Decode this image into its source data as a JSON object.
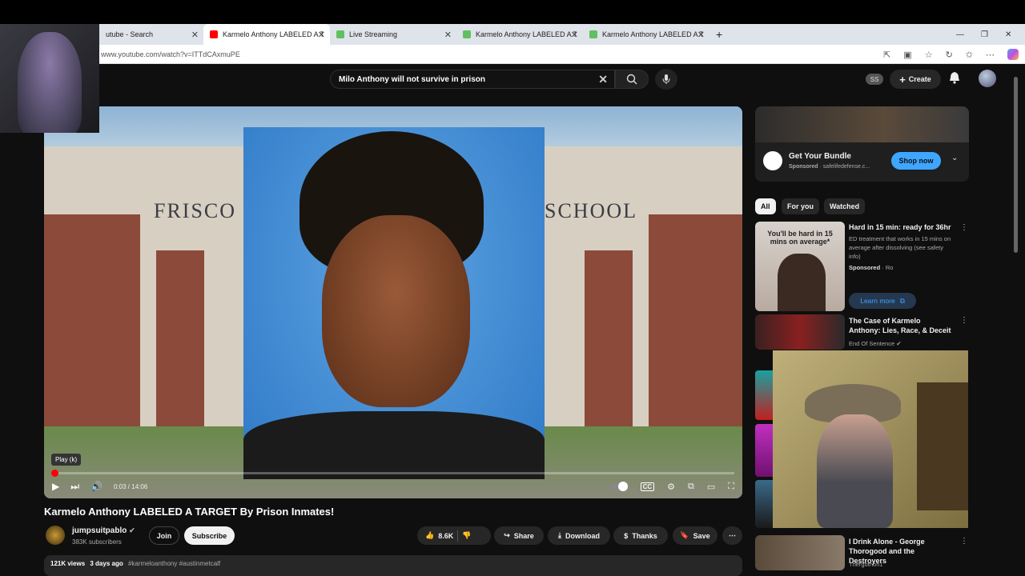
{
  "browser": {
    "tabs": [
      {
        "label": "utube - Search",
        "favicon_color": "#dfe3ea",
        "active": false
      },
      {
        "label": "Karmelo Anthony LABELED A TAR",
        "favicon_color": "#ff0000",
        "active": true
      },
      {
        "label": "Live Streaming",
        "favicon_color": "#60c060",
        "active": false
      },
      {
        "label": "Karmelo Anthony LABELED A TAR",
        "favicon_color": "#60c060",
        "active": false
      },
      {
        "label": "Karmelo Anthony LABELED A TAR",
        "favicon_color": "#60c060",
        "active": false
      }
    ],
    "url": "www.youtube.com/watch?v=ITTdCAxmuPE"
  },
  "header": {
    "search_query": "Milo Anthony will not survive in prison",
    "account_badge": "SS",
    "create_label": "Create"
  },
  "video": {
    "sign_left": "FRISCO",
    "sign_right": "SCHOOL",
    "tooltip": "Play (k)",
    "time_current": "0:03",
    "time_sep": " / ",
    "time_total": "14:06",
    "progress_fraction": 0.004
  },
  "meta": {
    "title": "Karmelo Anthony LABELED A TARGET By Prison Inmates!",
    "channel": "jumpsuitpablo",
    "subscribers": "383K subscribers",
    "join_label": "Join",
    "subscribe_label": "Subscribe",
    "likes": "8.6K",
    "share_label": "Share",
    "download_label": "Download",
    "thanks_label": "Thanks",
    "save_label": "Save",
    "views": "121K views",
    "age": "3 days ago",
    "tags": "#karmeloanthony #austinmetcalf"
  },
  "ad": {
    "title": "Get Your Bundle",
    "sponsored": "Sponsored",
    "domain": "safelifedefense.c...",
    "cta": "Shop now"
  },
  "chips": [
    "All",
    "For you",
    "Watched"
  ],
  "recommendations": [
    {
      "thumb_text": "You'll be hard in 15 mins on average*",
      "title": "Hard in 15 min: ready for 36hr",
      "sub1": "ED treatment that works in 15 mins on average after dissolving (see safety info)",
      "sponsored": "Sponsored",
      "sponsor_name": "Ro",
      "cta": "Learn more"
    },
    {
      "title": "The Case of Karmelo Anthony: Lies, Race, & Deceit",
      "channel": "End Of Sentence"
    },
    {
      "title": "I Drink Alone - George Thorogood and the Destroyers",
      "channel": "Thergothon1"
    }
  ],
  "colors": {
    "yt_red": "#ff0000",
    "accent_blue": "#3ea6ff",
    "bg": "#0f0f0f"
  }
}
